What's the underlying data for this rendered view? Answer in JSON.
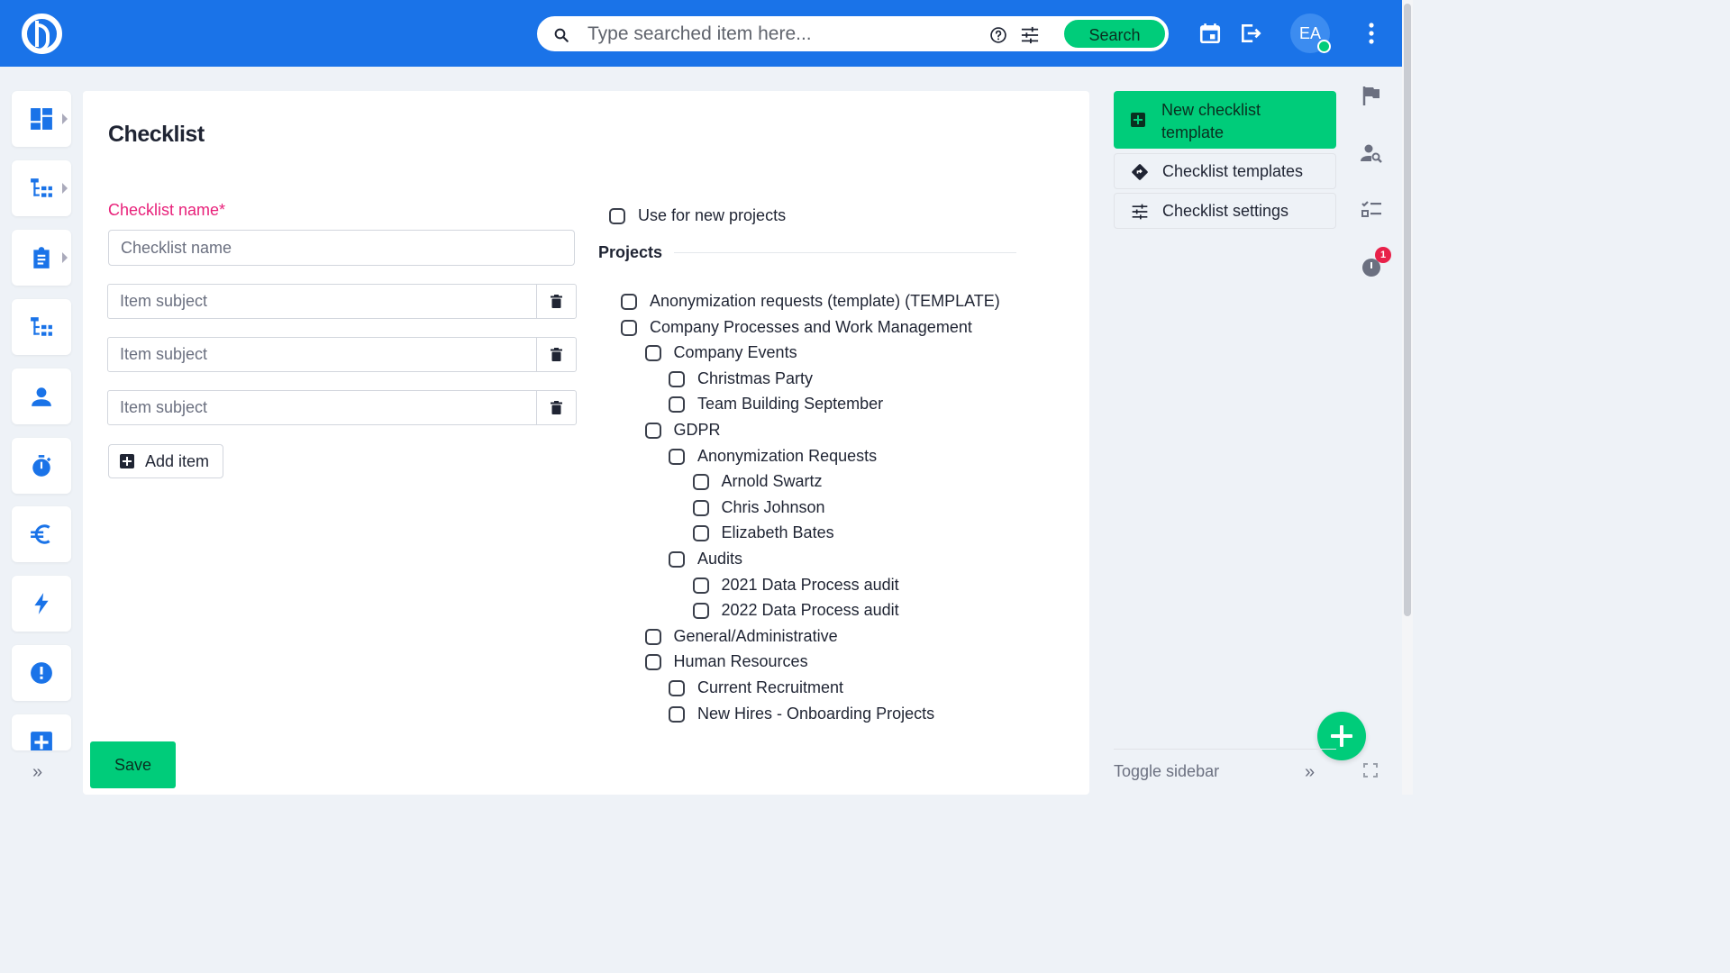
{
  "header": {
    "search_placeholder": "Type searched item here...",
    "search_button": "Search",
    "avatar_initials": "EA"
  },
  "page": {
    "title": "Checklist",
    "name_label": "Checklist name*",
    "name_placeholder": "Checklist name",
    "item_placeholder": "Item subject",
    "add_item_label": "Add item",
    "use_new_projects_label": "Use for new projects",
    "projects_heading": "Projects",
    "save_label": "Save"
  },
  "projects": [
    {
      "label": "Anonymization requests (template) (TEMPLATE)",
      "level": 0
    },
    {
      "label": "Company Processes and Work Management",
      "level": 0
    },
    {
      "label": "Company Events",
      "level": 1
    },
    {
      "label": "Christmas Party",
      "level": 2
    },
    {
      "label": "Team Building September",
      "level": 2
    },
    {
      "label": "GDPR",
      "level": 1
    },
    {
      "label": "Anonymization Requests",
      "level": 2
    },
    {
      "label": "Arnold Swartz",
      "level": 3
    },
    {
      "label": "Chris Johnson",
      "level": 3
    },
    {
      "label": "Elizabeth Bates",
      "level": 3
    },
    {
      "label": "Audits",
      "level": 2
    },
    {
      "label": "2021 Data Process audit",
      "level": 3
    },
    {
      "label": "2022 Data Process audit",
      "level": 3
    },
    {
      "label": "General/Administrative",
      "level": 1
    },
    {
      "label": "Human Resources",
      "level": 1
    },
    {
      "label": "Current Recruitment",
      "level": 2
    },
    {
      "label": "New Hires - Onboarding Projects",
      "level": 2
    }
  ],
  "right_panel": {
    "new_template": "New checklist template",
    "templates": "Checklist templates",
    "settings": "Checklist settings",
    "timer_badge": "1",
    "toggle_sidebar": "Toggle sidebar",
    "toggle_arrows": "»"
  },
  "left_nav": {
    "more": "»",
    "items": [
      "dashboard-icon",
      "projects-tree-icon",
      "tasks-clipboard-icon",
      "structure-icon",
      "user-icon",
      "timer-icon",
      "euro-icon",
      "lightning-icon",
      "alert-icon",
      "add-box-icon"
    ]
  },
  "colors": {
    "topbar": "#1a73e8",
    "accent_green": "#00cc7a",
    "nav_icon_blue": "#1a73e8",
    "required_pink": "#e8217a"
  }
}
